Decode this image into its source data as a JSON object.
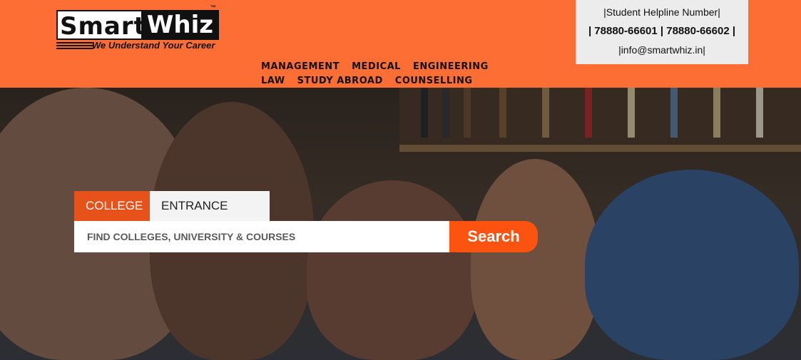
{
  "brand": {
    "logo_part1": "Sm",
    "logo_part2": "art",
    "logo_part3": "Whiz",
    "trademark": "™",
    "tagline": "We Understand Your Career"
  },
  "nav": {
    "items": [
      {
        "label": "MANAGEMENT"
      },
      {
        "label": "MEDICAL"
      },
      {
        "label": "ENGINEERING"
      },
      {
        "label": "LAW"
      },
      {
        "label": "STUDY ABROAD"
      },
      {
        "label": "COUNSELLING"
      }
    ]
  },
  "helpline": {
    "title": "|Student Helpline Number|",
    "phones": "| 78880-66601 | 78880-66602 |",
    "email": "|info@smartwhiz.in|"
  },
  "search": {
    "tabs": [
      {
        "label": "COLLEGE"
      },
      {
        "label": "ENTRANCE EXAM"
      }
    ],
    "placeholder": "FIND COLLEGES, UNIVERSITY & COURSES",
    "button_label": "Search"
  },
  "colors": {
    "header_bg": "#fd6e34",
    "accent": "#e7521b",
    "search_button": "#fd5310"
  }
}
